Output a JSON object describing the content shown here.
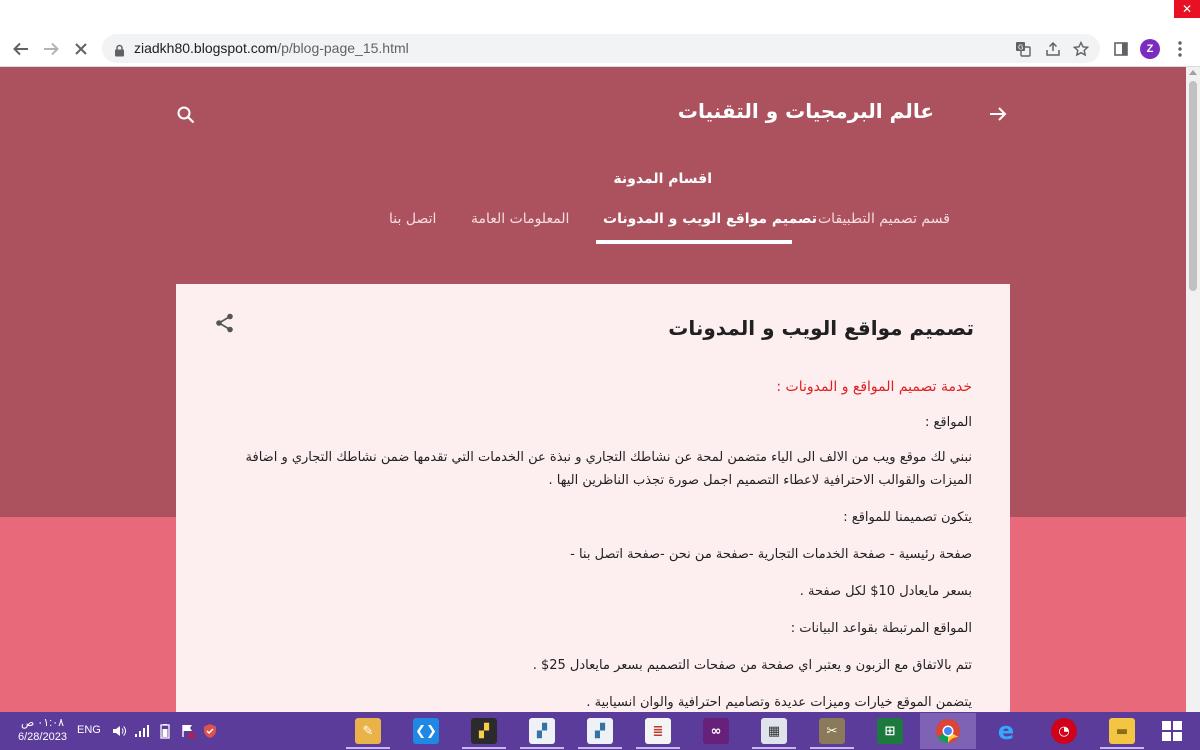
{
  "browser": {
    "url_host": "ziadkh80.blogspot.com",
    "url_path": "/p/blog-page_15.html",
    "avatar_letter": "Z",
    "close_glyph": "✕",
    "icons": [
      "back-arrow-icon",
      "forward-arrow-icon",
      "stop-loading-icon",
      "lock-icon",
      "translate-icon",
      "share-icon",
      "bookmark-star-icon",
      "side-panel-icon",
      "menu-dots-icon"
    ]
  },
  "blog": {
    "title": "عالم البرمجيات و التقنيات",
    "sections_label": "اقسام المدونة",
    "tabs": [
      {
        "label": "قسم تصميم التطبيقات",
        "active": false
      },
      {
        "label": "تصميم مواقع الويب و المدونات",
        "active": true
      },
      {
        "label": "المعلومات العامة",
        "active": false
      },
      {
        "label": "اتصل بنا",
        "active": false
      }
    ],
    "colors": {
      "hero": "#ac525e",
      "page": "#e8697a",
      "card": "#fdeef0",
      "accent_red": "#e02020"
    }
  },
  "post": {
    "title": "تصميم مواقع الويب و المدونات",
    "paragraphs": [
      "خدمة تصميم المواقع و المدونات :",
      "المواقع :",
      "نبني لك موقع ويب من الالف الى الياء متضمن لمحة عن نشاطك التجاري و نبذة عن الخدمات التي تقدمها ضمن نشاطك التجاري و اضافة الميزات والقوالب الاحترافية لاعطاء التصميم اجمل صورة تجذب الناظرين اليها .",
      "يتكون تصميمنا للمواقع :",
      "صفحة رئيسية - صفحة الخدمات التجارية -صفحة من نحن -صفحة اتصل بنا -",
      "بسعر مايعادل 10$ لكل صفحة .",
      "المواقع المرتبطة بقواعد البيانات :",
      "تتم بالاتفاق مع الزبون و يعتبر اي صفحة من صفحات التصميم بسعر مايعادل 25$ .",
      "يتضمن الموقع خيارات وميزات عديدة وتصاميم احترافية والوان انسيابية ."
    ]
  },
  "taskbar": {
    "time": "٠١:٠٨ ص",
    "date": "6/28/2023",
    "language": "ENG",
    "apps": [
      "paint-icon",
      "vscode-icon",
      "python-idle-icon",
      "python-file-icon",
      "python-file-icon-2",
      "notepad-icon",
      "visual-studio-icon",
      "calculator-icon",
      "tools-icon",
      "excel-icon",
      "chrome-icon",
      "internet-explorer-icon",
      "app-red-icon",
      "file-explorer-icon",
      "windows-start-icon"
    ]
  }
}
